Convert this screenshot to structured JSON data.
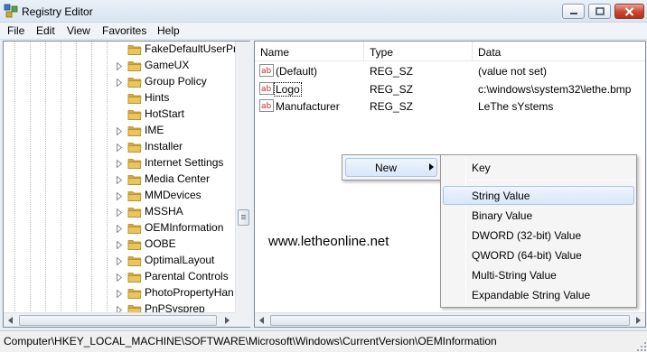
{
  "window": {
    "title": "Registry Editor",
    "icon": "registry-icon",
    "controls": [
      "minimize-icon",
      "maximize-icon",
      "close-icon"
    ]
  },
  "menubar": {
    "items": [
      "File",
      "Edit",
      "View",
      "Favorites",
      "Help"
    ]
  },
  "tree": {
    "items": [
      {
        "label": "FakeDefaultUserPr",
        "expandable": false
      },
      {
        "label": "GameUX",
        "expandable": true
      },
      {
        "label": "Group Policy",
        "expandable": true
      },
      {
        "label": "Hints",
        "expandable": false
      },
      {
        "label": "HotStart",
        "expandable": false
      },
      {
        "label": "IME",
        "expandable": true
      },
      {
        "label": "Installer",
        "expandable": true
      },
      {
        "label": "Internet Settings",
        "expandable": true
      },
      {
        "label": "Media Center",
        "expandable": true
      },
      {
        "label": "MMDevices",
        "expandable": true
      },
      {
        "label": "MSSHA",
        "expandable": true
      },
      {
        "label": "OEMInformation",
        "expandable": true
      },
      {
        "label": "OOBE",
        "expandable": true
      },
      {
        "label": "OptimalLayout",
        "expandable": true
      },
      {
        "label": "Parental Controls",
        "expandable": true
      },
      {
        "label": "PhotoPropertyHan",
        "expandable": true
      },
      {
        "label": "PnPSysprep",
        "expandable": true
      }
    ]
  },
  "list": {
    "columns": [
      "Name",
      "Type",
      "Data"
    ],
    "rows": [
      {
        "name": "(Default)",
        "type": "REG_SZ",
        "data": "(value not set)",
        "icon": "string-value-icon"
      },
      {
        "name": "Logo",
        "type": "REG_SZ",
        "data": "c:\\windows\\system32\\lethe.bmp",
        "icon": "string-value-icon"
      },
      {
        "name": "Manufacturer",
        "type": "REG_SZ",
        "data": "LeThe sYstems",
        "icon": "string-value-icon"
      }
    ]
  },
  "watermark": "www.letheonline.net",
  "context_menu": {
    "new_label": "New",
    "submenu": [
      "Key",
      "String Value",
      "Binary Value",
      "DWORD (32-bit) Value",
      "QWORD (64-bit) Value",
      "Multi-String Value",
      "Expandable String Value"
    ],
    "highlighted": "String Value"
  },
  "statusbar": {
    "path": "Computer\\HKEY_LOCAL_MACHINE\\SOFTWARE\\Microsoft\\Windows\\CurrentVersion\\OEMInformation"
  },
  "colors": {
    "folder": "#e9c55a",
    "highlight": "#d9e7f8",
    "close_button": "#c9442d"
  }
}
